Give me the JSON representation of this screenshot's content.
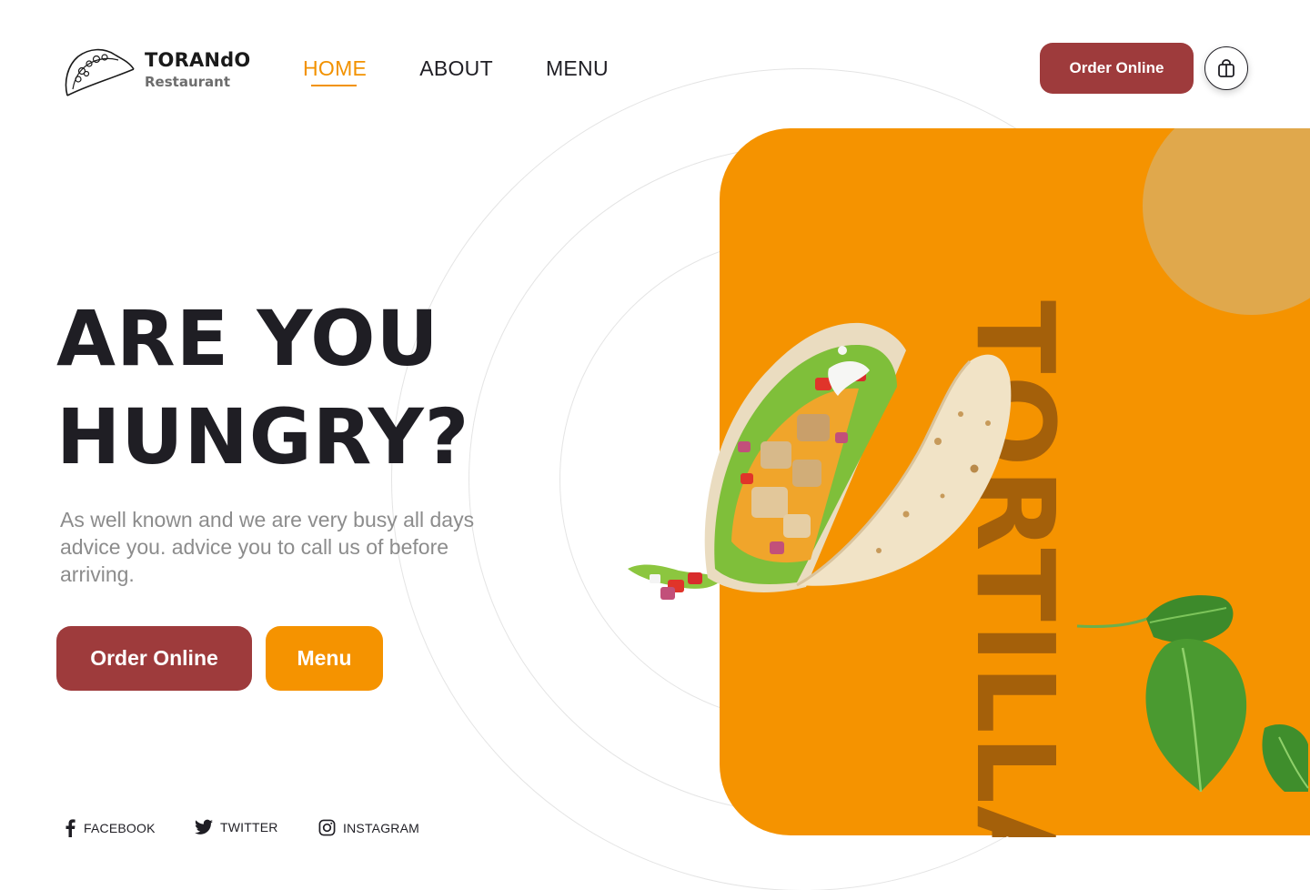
{
  "brand": {
    "name": "TORANdO",
    "subtitle": "Restaurant"
  },
  "nav": {
    "items": [
      {
        "label": "HOME",
        "active": true
      },
      {
        "label": "ABOUT",
        "active": false
      },
      {
        "label": "MENU",
        "active": false
      }
    ]
  },
  "header": {
    "order_label": "Order Online",
    "cart_icon": "shopping-bag-icon"
  },
  "hero": {
    "title_line1": "ARE YOU",
    "title_line2": "HUNGRY?",
    "description": "As well known and we are very busy all days advice you. advice you to call us of before arriving.",
    "primary_button": "Order Online",
    "secondary_button": "Menu"
  },
  "social": {
    "facebook": "FACEBOOK",
    "twitter": "TWITTER",
    "instagram": "INSTAGRAM"
  },
  "panel": {
    "vertical_text": "TORTILLA"
  },
  "colors": {
    "accent": "#f59300",
    "brand_red": "#9e3b3c",
    "text_dark": "#1f1e24",
    "text_muted": "#8c8c8c",
    "panel_circle": "#e0a84c",
    "panel_text": "#a4600a"
  }
}
